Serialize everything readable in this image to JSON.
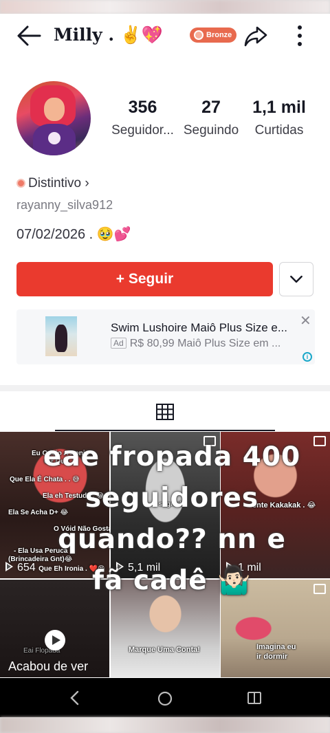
{
  "header": {
    "title": "Milly . ✌️💖",
    "badge": "Bronze"
  },
  "profile": {
    "stats": [
      {
        "value": "356",
        "label": "Seguidor..."
      },
      {
        "value": "27",
        "label": "Seguindo"
      },
      {
        "value": "1,1 mil",
        "label": "Curtidas"
      }
    ],
    "distintivo": "Distintivo ›",
    "handle": "rayanny_silva912",
    "bio": "07/02/2026 . 🥹💕",
    "follow_label": "+  Seguir"
  },
  "ad": {
    "title": "Swim Lushoire Maiô Plus Size e...",
    "tag": "Ad",
    "subtitle": "R$ 80,99 Maiô Plus Size em ...",
    "close": "✕",
    "info": "i"
  },
  "overlay_text": "eae fropada 400 seguidores quando?? nn e fã cadê 🤷🏻‍♂️",
  "videos": [
    {
      "views": "654",
      "captions": [
        "Eu Odeio A Ironia",
        "Cir Que",
        "Que Ela É Chata . . 😅",
        "Ela eh Testuda . 😂",
        "Ela Se Acha D+ 😂",
        "O Vóid Não Gosta Dela",
        "- Ela Usa Peruca",
        "(Brincadeira Gnt)😂",
        "Que Eh Ironia . ❤️😍"
      ]
    },
    {
      "views": "5,1 mil",
      "captions": [
        "sagrado"
      ]
    },
    {
      "views": "1 mil",
      "captions": [
        "ente Kakakak . 😂"
      ]
    },
    {
      "label": "Acabou de ver",
      "captions": [
        "Eai Flopada"
      ]
    },
    {
      "captions": [
        "Marque Uma Conta!"
      ]
    },
    {
      "captions": [
        "Imagina eu",
        "ir dormir"
      ]
    }
  ],
  "colors": {
    "follow": "#ea3a2e",
    "badge": "#e86a4e",
    "text": "#161823"
  }
}
